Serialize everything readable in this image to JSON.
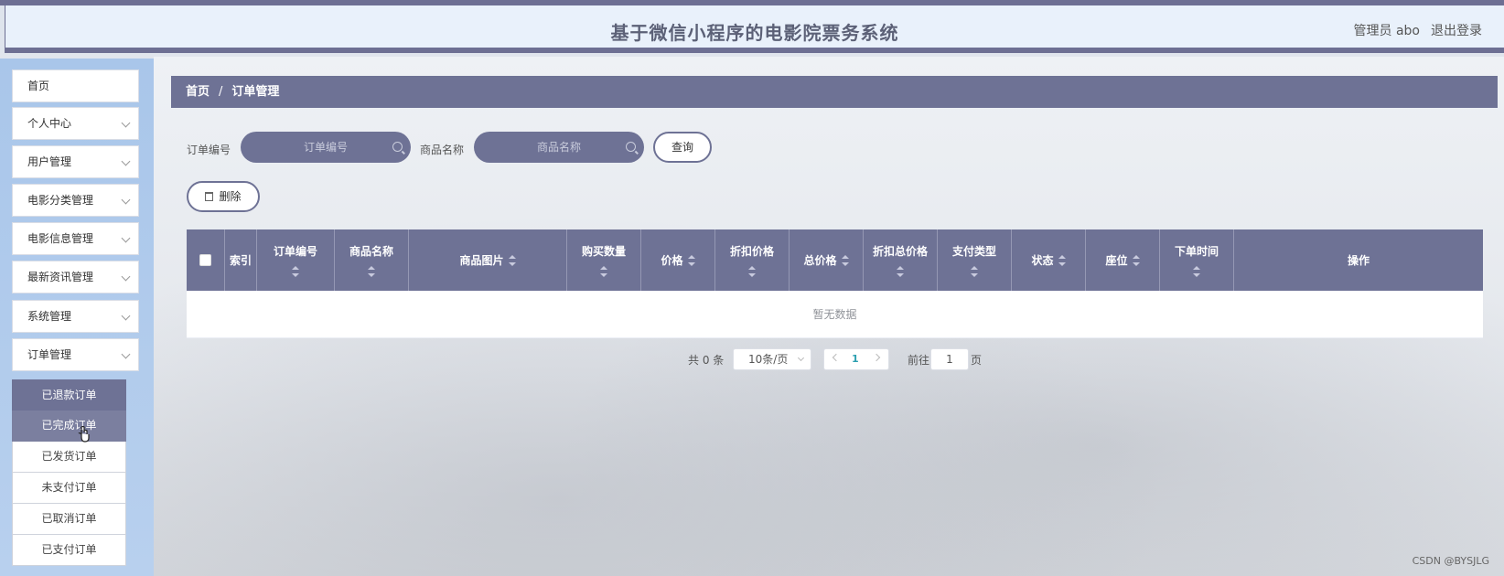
{
  "header": {
    "title": "基于微信小程序的电影院票务系统",
    "user": "管理员 abo",
    "logout": "退出登录"
  },
  "sidebar": {
    "items": [
      {
        "label": "首页",
        "has_children": false
      },
      {
        "label": "个人中心",
        "has_children": true
      },
      {
        "label": "用户管理",
        "has_children": true
      },
      {
        "label": "电影分类管理",
        "has_children": true
      },
      {
        "label": "电影信息管理",
        "has_children": true
      },
      {
        "label": "最新资讯管理",
        "has_children": true
      },
      {
        "label": "系统管理",
        "has_children": true
      },
      {
        "label": "订单管理",
        "has_children": true
      }
    ],
    "order_submenu": [
      "已退款订单",
      "已完成订单",
      "已发货订单",
      "未支付订单",
      "已取消订单",
      "已支付订单"
    ]
  },
  "breadcrumb": {
    "home": "首页",
    "separator": "/",
    "current": "订单管理"
  },
  "filters": {
    "order_no_label": "订单编号",
    "order_no_placeholder": "订单编号",
    "product_name_label": "商品名称",
    "product_name_placeholder": "商品名称",
    "query_button": "查询",
    "delete_button": "删除"
  },
  "table": {
    "columns": {
      "index": "索引",
      "order_no": "订单编号",
      "product_name": "商品名称",
      "product_image": "商品图片",
      "quantity": "购买数量",
      "price": "价格",
      "discount_price": "折扣价格",
      "total_price": "总价格",
      "discount_total": "折扣总价格",
      "payment_type": "支付类型",
      "status": "状态",
      "seat": "座位",
      "order_time": "下单时间",
      "actions": "操作"
    },
    "rows": [],
    "empty_text": "暂无数据"
  },
  "pagination": {
    "total": "共 0 条",
    "page_size": "10条/页",
    "current_page": "1",
    "goto_label": "前往",
    "goto_value": "1",
    "page_suffix": "页"
  },
  "watermark": "CSDN @BYSJLG",
  "colors": {
    "accent": "#6e7295",
    "sidebar": "#a9c6ea",
    "header_bg": "#e9f1fb"
  }
}
